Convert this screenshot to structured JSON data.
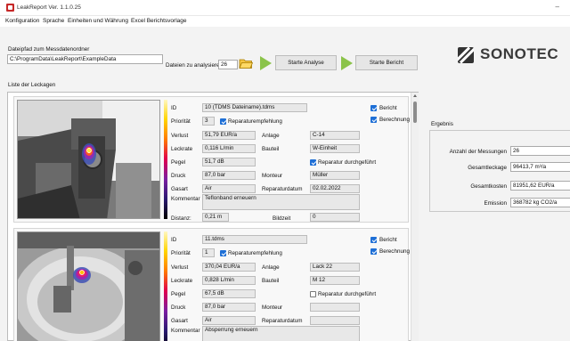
{
  "window": {
    "title": "LeakReport Ver. 1.1.0.25",
    "minimize_glyph": "–"
  },
  "menu": {
    "items": [
      "Konfiguration",
      "Sprache",
      "Einheiten und Währung",
      "Excel Berichtsvorlage"
    ]
  },
  "path_section": {
    "label": "Dateipfad zum Messdatenordner",
    "path_value": "C:\\ProgramData\\LeakReport\\ExampleData",
    "analyze_label": "Dateien zu analysieren",
    "analyze_count": "26",
    "start_analysis": "Starte Analyse",
    "start_report": "Starte Bericht"
  },
  "logo": {
    "text": "SONOTEC"
  },
  "list_title": "Liste der Leckagen",
  "field_labels": {
    "id": "ID",
    "priority": "Priorität",
    "loss": "Verlust",
    "leak_rate": "Leckrate",
    "level": "Pegel",
    "pressure": "Druck",
    "gas": "Gasart",
    "comment": "Kommentar",
    "distance": "Distanz:",
    "plant": "Anlage",
    "component": "Bauteil",
    "technician": "Monteur",
    "repair_date": "Reparaturdatum",
    "image_time": "Bildzeit",
    "repair_recommendation": "Reparaturempfehlung",
    "repair_done": "Reparatur durchgeführt",
    "report": "Bericht",
    "calculation": "Berechnung"
  },
  "leaks": [
    {
      "id": "10 (TDMS Dateiname).tdms",
      "priority": "3",
      "repair_recommendation": true,
      "loss": "51,79 EUR/a",
      "leak_rate": "0,116 L/min",
      "level": "51,7 dB",
      "pressure": "87,0 bar",
      "gas": "Air",
      "plant": "C-14",
      "component": "W-Einheit",
      "repair_done": true,
      "technician": "Müller",
      "repair_date": "02.02.2022",
      "comment": "Teflonband erneuern",
      "distance": "0,21 m",
      "image_time": "0",
      "report": true,
      "calculation": true
    },
    {
      "id": "11.tdms",
      "priority": "1",
      "repair_recommendation": true,
      "loss": "370,04 EUR/a",
      "leak_rate": "0,828 L/min",
      "level": "67,5 dB",
      "pressure": "87,0 bar",
      "gas": "Air",
      "plant": "Lack 22",
      "component": "M 12",
      "repair_done": false,
      "technician": "",
      "repair_date": "",
      "comment": "Absperrung erneuern",
      "report": true,
      "calculation": true
    }
  ],
  "results": {
    "title": "Ergebnis",
    "rows": [
      {
        "label": "Anzahl der Messungen",
        "value": "26"
      },
      {
        "label": "Gesamtleckage",
        "value": "96413,7 m³/a"
      },
      {
        "label": "Gesamtkosten",
        "value": "81951,62 EUR/a"
      },
      {
        "label": "Emission",
        "value": "368782 kg CO2/a"
      }
    ]
  },
  "colors": {
    "accent": "#1e6fd6",
    "play_green": "#8bc34a",
    "logo_dark": "#3a3a3a",
    "app_red": "#c62828"
  }
}
